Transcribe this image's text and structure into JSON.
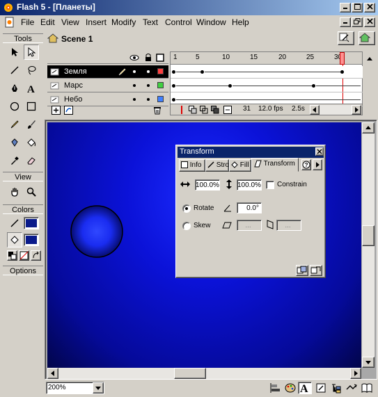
{
  "window": {
    "title": "Flash 5 - [Планеты]"
  },
  "menu": {
    "items": [
      "File",
      "Edit",
      "View",
      "Insert",
      "Modify",
      "Text",
      "Control",
      "Window",
      "Help"
    ]
  },
  "scene": {
    "name": "Scene 1"
  },
  "tools_panel": {
    "header": "Tools",
    "view_header": "View",
    "colors_header": "Colors",
    "options_header": "Options",
    "stroke_color": "#0a1a8a",
    "fill_color": "#0a1a8a"
  },
  "timeline": {
    "frame_numbers": [
      "1",
      "5",
      "10",
      "15",
      "20",
      "25",
      "30"
    ],
    "current_frame": "31",
    "frame_rate": "12.0 fps",
    "elapsed_time": "2.5s",
    "layers": [
      {
        "name": "Земля",
        "selected": true,
        "color": "#ff4040"
      },
      {
        "name": "Марс",
        "selected": false,
        "color": "#40d040"
      },
      {
        "name": "Небо",
        "selected": false,
        "color": "#4080ff"
      }
    ]
  },
  "transform_panel": {
    "title": "Transform",
    "tabs": [
      "Info",
      "Stroke",
      "Fill",
      "Transform"
    ],
    "width_value": "100.0%",
    "height_value": "100.0%",
    "constrain_label": "Constrain",
    "rotate_label": "Rotate",
    "rotate_value": "0.0°",
    "skew_label": "Skew",
    "skew_h_value": "...",
    "skew_v_value": "..."
  },
  "status": {
    "zoom": "200%"
  },
  "colors": {
    "stage_blue": "#0b12d8",
    "planet_blue": "#1a2cff",
    "title_blue": "#0a246a"
  }
}
